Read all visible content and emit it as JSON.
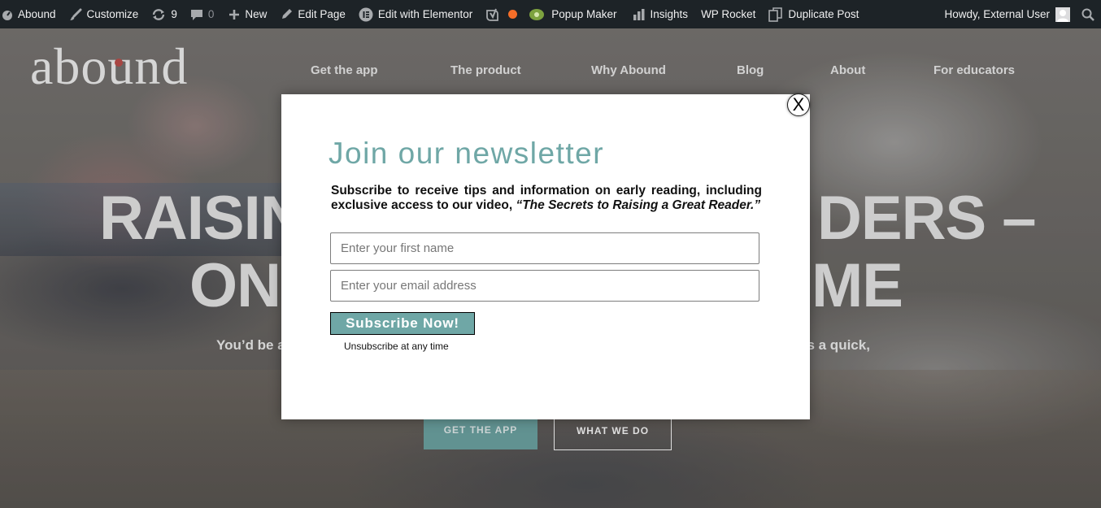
{
  "admin_bar": {
    "site_name": "Abound",
    "customize": "Customize",
    "updates_count": "9",
    "comments_count": "0",
    "new": "New",
    "edit_page": "Edit Page",
    "edit_elementor": "Edit with Elementor",
    "popup_maker": "Popup Maker",
    "insights": "Insights",
    "wp_rocket": "WP Rocket",
    "duplicate_post": "Duplicate Post",
    "howdy": "Howdy, External User"
  },
  "site": {
    "logo_text": "abound",
    "nav": [
      "Get the app",
      "The product",
      "Why Abound",
      "Blog",
      "About",
      "For educators"
    ]
  },
  "hero": {
    "headline_line1_left": "RAISIN",
    "headline_line1_right": "DERS –",
    "headline_line2_left": "ON",
    "headline_line2_right": "ME",
    "subtitle_left": "You’d be a",
    "subtitle_right": "es a quick,",
    "btn_app": "GET THE APP",
    "btn_what": "WHAT WE DO"
  },
  "popup": {
    "close": "X",
    "title": "Join our newsletter",
    "description": "Subscribe to receive tips and information on early reading, including exclusive access to our video,",
    "description_quote": "“The Secrets to Raising a Great Reader.”",
    "first_name_placeholder": "Enter your first name",
    "email_placeholder": "Enter your email address",
    "subscribe_label": "Subscribe Now!",
    "unsubscribe_note": "Unsubscribe at any time"
  }
}
